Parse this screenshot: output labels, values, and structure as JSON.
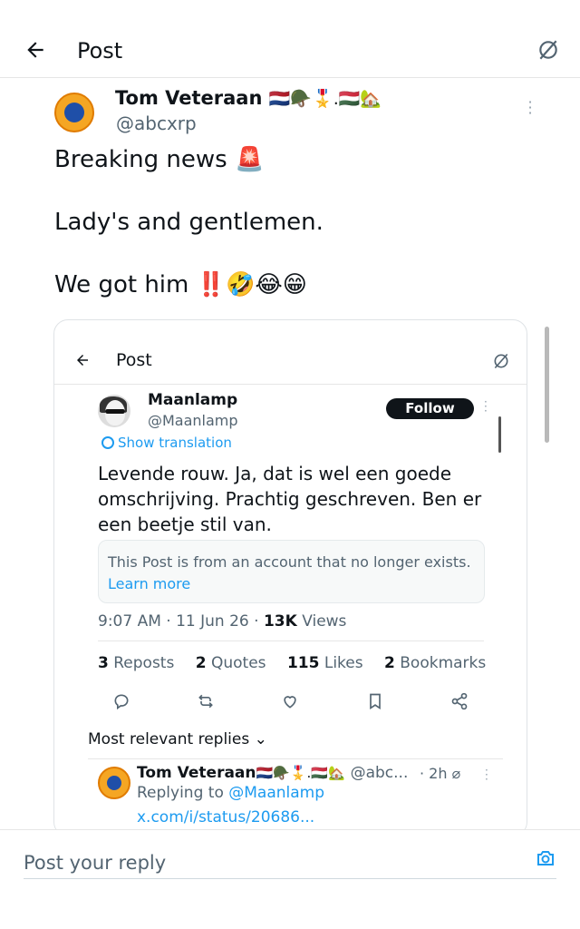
{
  "header": {
    "title": "Post",
    "back_icon": "arrow-left-icon",
    "grok_icon": "grok-icon"
  },
  "post": {
    "author_name": "Tom Veteraan",
    "author_emojis": "🇳🇱🪖🎖️.🇭🇺🏡",
    "author_handle": "@abcxrp",
    "lines": [
      "Breaking news 🚨",
      "Lady's and gentlemen.",
      "We got him ‼️🤣😂😁"
    ]
  },
  "embedded": {
    "header_title": "Post",
    "author_name": "Maanlamp",
    "author_handle": "@Maanlamp",
    "follow_label": "Follow",
    "show_translation": "Show translation",
    "body_lines": [
      "Levende rouw. Ja, dat is wel een goede",
      "omschrijving. Prachtig geschreven. Ben er",
      "een beetje stil van."
    ],
    "notice_text": "This Post is from an account that no longer exists.",
    "notice_link": "Learn more",
    "time": "9:07 AM",
    "date": "11 Jun 26",
    "views_count": "13K",
    "views_label": "Views",
    "stats": [
      {
        "count": "3",
        "label": "Reposts"
      },
      {
        "count": "2",
        "label": "Quotes"
      },
      {
        "count": "115",
        "label": "Likes"
      },
      {
        "count": "2",
        "label": "Bookmarks"
      }
    ],
    "actions": [
      "reply-icon",
      "repost-icon",
      "like-icon",
      "bookmark-icon",
      "share-icon"
    ],
    "relevant_label": "Most relevant replies",
    "reply": {
      "author_name": "Tom Veteraan",
      "author_emojis": "🇳🇱🪖🎖️.🇭🇺🏡",
      "handle": "@abc...",
      "time": "· 2h",
      "replying_prefix": "Replying to",
      "replying_to": "@Maanlamp",
      "link": "x.com/i/status/20686..."
    }
  },
  "reply_bar": {
    "placeholder": "Post your reply",
    "camera_icon": "camera-icon"
  },
  "colors": {
    "link": "#1d9bf0",
    "text": "#0f1419",
    "muted": "#536471"
  }
}
